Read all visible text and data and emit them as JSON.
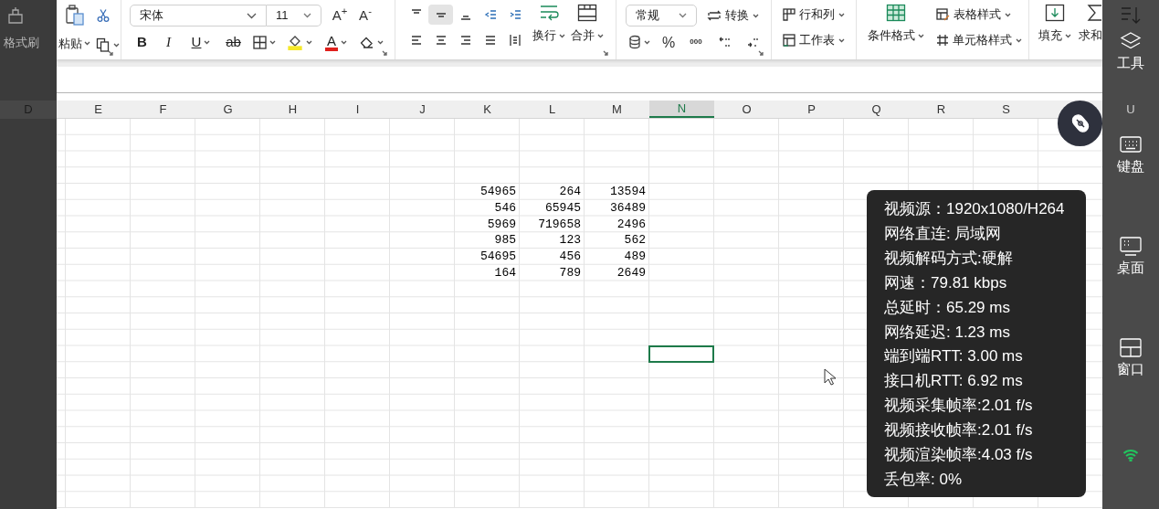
{
  "ribbon": {
    "format_painter": "格式刷",
    "paste": "粘贴",
    "font_family": "宋体",
    "font_size": "11",
    "increase_font": "A$^{+}$",
    "decrease_font": "A$^{-}$",
    "font_styles": [
      {
        "kind": "bold",
        "text": "B"
      },
      {
        "kind": "italic",
        "text": "I"
      },
      {
        "kind": "underline",
        "text": "U"
      },
      {
        "kind": "strike",
        "text": "ab"
      }
    ],
    "font_color": "A",
    "vertical_align": [
      {
        "selected": false
      },
      {
        "selected": true
      },
      {
        "selected": false
      }
    ],
    "wrap_text": "换行",
    "merge": "合并",
    "number_format": "常规",
    "convert": "转换",
    "percent": "%",
    "thousands": "000",
    "rows_columns": "行和列",
    "worksheet": "工作表",
    "conditional_format": "条件格式",
    "table_style": "表格样式",
    "cell_style": "单元格样式",
    "fill": "填充",
    "sum": "求和"
  },
  "sheet": {
    "columns": [
      {
        "label": "D",
        "selected": false
      },
      {
        "label": "E",
        "selected": false
      },
      {
        "label": "F",
        "selected": false
      },
      {
        "label": "G",
        "selected": false
      },
      {
        "label": "H",
        "selected": false
      },
      {
        "label": "I",
        "selected": false
      },
      {
        "label": "J",
        "selected": false
      },
      {
        "label": "K",
        "selected": false
      },
      {
        "label": "L",
        "selected": false
      },
      {
        "label": "M",
        "selected": false
      },
      {
        "label": "N",
        "selected": true
      },
      {
        "label": "O",
        "selected": false
      },
      {
        "label": "P",
        "selected": false
      },
      {
        "label": "Q",
        "selected": false
      },
      {
        "label": "R",
        "selected": false
      },
      {
        "label": "S",
        "selected": false
      }
    ],
    "rows": [
      [
        "54965",
        "264",
        "13594"
      ],
      [
        "546",
        "65945",
        "36489"
      ],
      [
        "5969",
        "719658",
        "2496"
      ],
      [
        "985",
        "123",
        "562"
      ],
      [
        "54695",
        "456",
        "489"
      ],
      [
        "164",
        "789",
        "2649"
      ]
    ]
  },
  "stats": [
    "视频源：1920x1080/H264",
    "网络直连: 局域网",
    "视频解码方式:硬解",
    "网速：79.81 kbps",
    "总延时：65.29 ms",
    "网络延迟: 1.23 ms",
    "端到端RTT: 3.00 ms",
    "接口机RTT: 6.92 ms",
    "视频采集帧率:2.01 f/s",
    "视频接收帧率:2.01 f/s",
    "视频渲染帧率:4.03 f/s",
    "丢包率: 0%"
  ],
  "sidebar": {
    "items": [
      {
        "kind": "tools",
        "label": "工具"
      },
      {
        "kind": "keyboard",
        "label": "键盘"
      },
      {
        "kind": "desktop",
        "label": "桌面"
      },
      {
        "kind": "window",
        "label": "窗口"
      }
    ],
    "column_header": "U"
  }
}
